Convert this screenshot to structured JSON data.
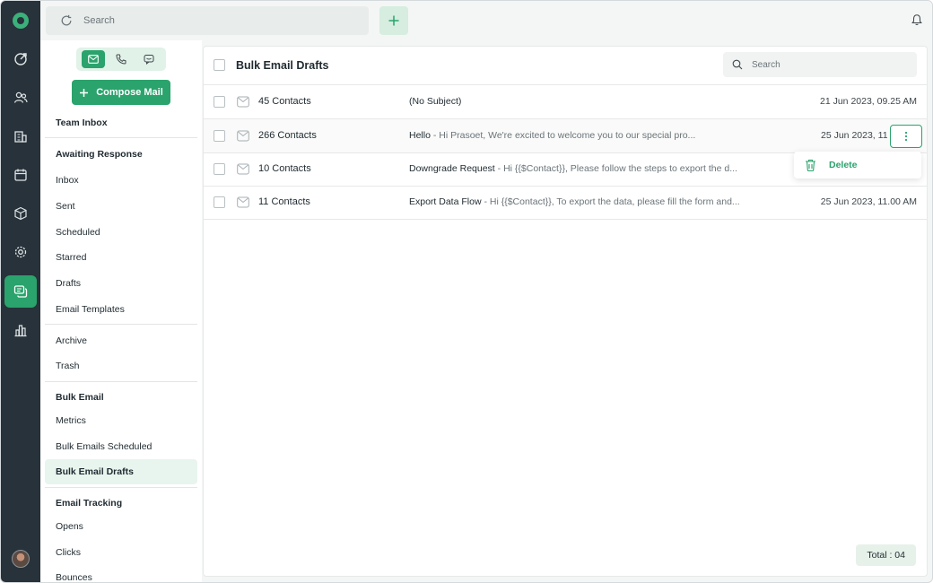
{
  "topbar": {
    "search_placeholder": "Search"
  },
  "sidebar": {
    "compose_label": "Compose Mail",
    "items": [
      {
        "label": "Team Inbox"
      },
      {
        "label": "Awaiting Response"
      },
      {
        "label": "Inbox"
      },
      {
        "label": "Sent"
      },
      {
        "label": "Scheduled"
      },
      {
        "label": "Starred"
      },
      {
        "label": "Drafts"
      },
      {
        "label": "Email Templates"
      },
      {
        "label": "Archive"
      },
      {
        "label": "Trash"
      },
      {
        "label": "Bulk Email"
      },
      {
        "label": "Metrics"
      },
      {
        "label": "Bulk Emails Scheduled"
      },
      {
        "label": "Bulk Email Drafts"
      },
      {
        "label": "Email Tracking"
      },
      {
        "label": "Opens"
      },
      {
        "label": "Clicks"
      },
      {
        "label": "Bounces"
      }
    ]
  },
  "main": {
    "title": "Bulk Email Drafts",
    "search_placeholder": "Search",
    "rows": [
      {
        "contacts": "45 Contacts",
        "subject": "(No Subject)",
        "preview": "",
        "date": "21 Jun 2023, 09.25 AM"
      },
      {
        "contacts": "266 Contacts",
        "subject": "Hello",
        "preview": "  -  Hi Prasoet, We're excited to welcome you to our special pro...",
        "date": "25 Jun 2023, 11.00 AM"
      },
      {
        "contacts": "10 Contacts",
        "subject": "Downgrade Request",
        "preview": "  -  Hi {{$Contact}}, Please follow the steps to export the  d...",
        "date": ""
      },
      {
        "contacts": "11 Contacts",
        "subject": "Export Data Flow",
        "preview": "  -  Hi {{$Contact}}, To export the data, please fill the form and...",
        "date": "25 Jun 2023, 11.00 AM"
      }
    ],
    "row_menu": {
      "delete_label": "Delete"
    },
    "total_label": "Total : 04"
  },
  "colors": {
    "accent": "#2aa36c",
    "rail": "#27323a",
    "selected_bg": "#e8f5ee"
  }
}
